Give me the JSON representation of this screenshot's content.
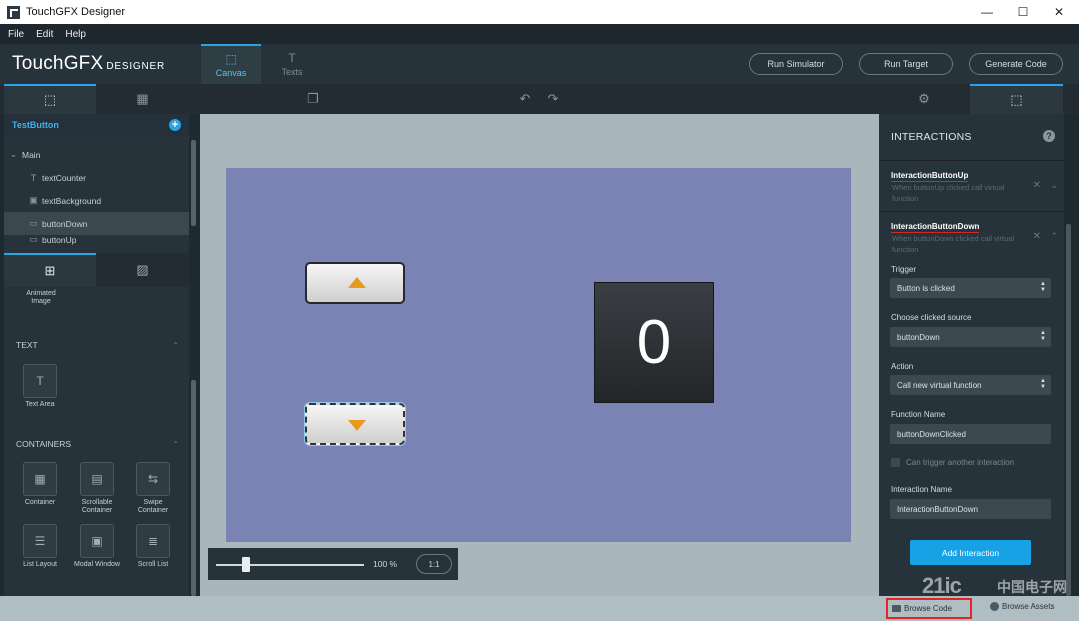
{
  "window": {
    "title": "TouchGFX Designer",
    "minimize": "—",
    "maximize": "☐",
    "close": "✕"
  },
  "menu": [
    "File",
    "Edit",
    "Help"
  ],
  "header": {
    "logo_main": "TouchGFX",
    "logo_sub": "DESIGNER",
    "tabs": [
      {
        "label": "Canvas",
        "icon": "canvas-icon"
      },
      {
        "label": "Texts",
        "icon": "texts-icon"
      }
    ],
    "buttons": [
      "Run Simulator",
      "Run Target",
      "Generate Code"
    ]
  },
  "left_panel": {
    "tree_title": "TestButton",
    "tree_root": "Main",
    "tree_items": [
      {
        "label": "textCounter",
        "icon": "text-icon"
      },
      {
        "label": "textBackground",
        "icon": "image-icon"
      },
      {
        "label": "buttonDown",
        "icon": "button-icon",
        "selected": true
      },
      {
        "label": "buttonUp",
        "icon": "button-icon"
      }
    ],
    "partial_widget": "Animated Image",
    "sections": [
      {
        "title": "TEXT",
        "widgets": [
          "Text Area"
        ]
      },
      {
        "title": "CONTAINERS",
        "widgets": [
          "Container",
          "Scrollable Container",
          "Swipe Container",
          "List Layout",
          "Modal Window",
          "Scroll List"
        ]
      }
    ]
  },
  "canvas": {
    "counter_value": "0",
    "zoom_label": "100 %",
    "zoom_fraction": 0.2,
    "one_to_one": "1:1"
  },
  "right_panel": {
    "title": "INTERACTIONS",
    "interactions": [
      {
        "name": "InteractionButtonUp",
        "desc": "When buttonUp clicked call virtual function"
      },
      {
        "name": "InteractionButtonDown",
        "desc": "When buttonDown clicked call virtual function"
      }
    ],
    "fields": {
      "trigger_label": "Trigger",
      "trigger_value": "Button is clicked",
      "source_label": "Choose clicked source",
      "source_value": "buttonDown",
      "action_label": "Action",
      "action_value": "Call new virtual function",
      "function_label": "Function Name",
      "function_value": "buttonDownClicked",
      "can_trigger_label": "Can trigger another interaction",
      "interaction_name_label": "Interaction Name",
      "interaction_name_value": "InteractionButtonDown"
    },
    "add_button": "Add Interaction"
  },
  "statusbar": {
    "browse_code": "Browse Code",
    "second_item": "Browse Assets"
  },
  "watermark": {
    "latin": "21ic",
    "cn": "中国电子网"
  },
  "colors": {
    "accent": "#2aa4e6",
    "screen_bg": "#7b83b5",
    "arrow": "#e79a1e",
    "highlight_red": "#e0262a"
  }
}
